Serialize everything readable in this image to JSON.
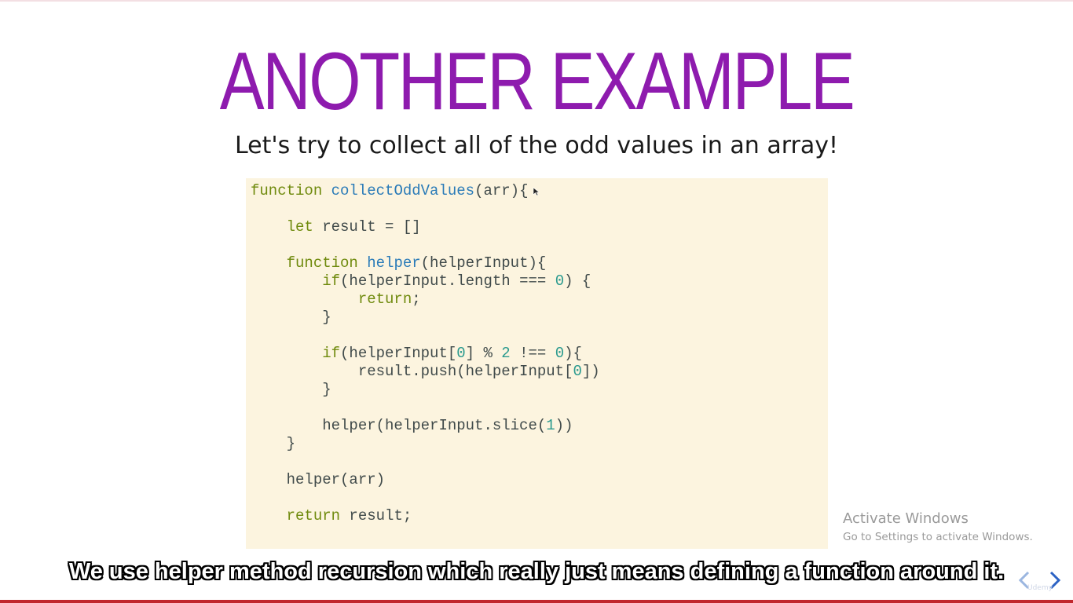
{
  "slide": {
    "title": "ANOTHER EXAMPLE",
    "subtitle": "Let's try to collect all of the odd values in an array!"
  },
  "code": {
    "l1": {
      "kw": "function",
      "fn": "collectOddValues",
      "rest": "(arr){"
    },
    "l2": {
      "kw": "let",
      "rest": " result = []"
    },
    "l3": {
      "kw": "function",
      "fn": "helper",
      "rest": "(helperInput){"
    },
    "l4": {
      "kw": "if",
      "a": "(helperInput.length === ",
      "num": "0",
      "b": ") {"
    },
    "l5": {
      "kw": "return",
      "rest": ";"
    },
    "l6": {
      "rest": "}"
    },
    "l7": {
      "kw": "if",
      "a": "(helperInput[",
      "num1": "0",
      "b": "] % ",
      "num2": "2",
      "c": " !== ",
      "num3": "0",
      "d": "){"
    },
    "l8": {
      "a": "result.push(helperInput[",
      "num": "0",
      "b": "])"
    },
    "l9": {
      "rest": "}"
    },
    "l10": {
      "a": "helper(helperInput.slice(",
      "num": "1",
      "b": "))"
    },
    "l11": {
      "rest": "}"
    },
    "l12": {
      "rest": "helper(arr)"
    },
    "l13": {
      "kw": "return",
      "rest": " result;"
    }
  },
  "windows_watermark": {
    "title": "Activate Windows",
    "subtitle": "Go to Settings to activate Windows."
  },
  "caption": "We use helper method recursion which really just means defining a function around it.",
  "nav": {
    "prev_icon": "chevron-left-icon",
    "next_icon": "chevron-right-icon"
  },
  "colors": {
    "title": "#8e1bae",
    "keyword": "#6f8a0d",
    "function_name": "#2a7bb8",
    "number": "#2a9a8e",
    "code_background": "#fcf4df"
  }
}
